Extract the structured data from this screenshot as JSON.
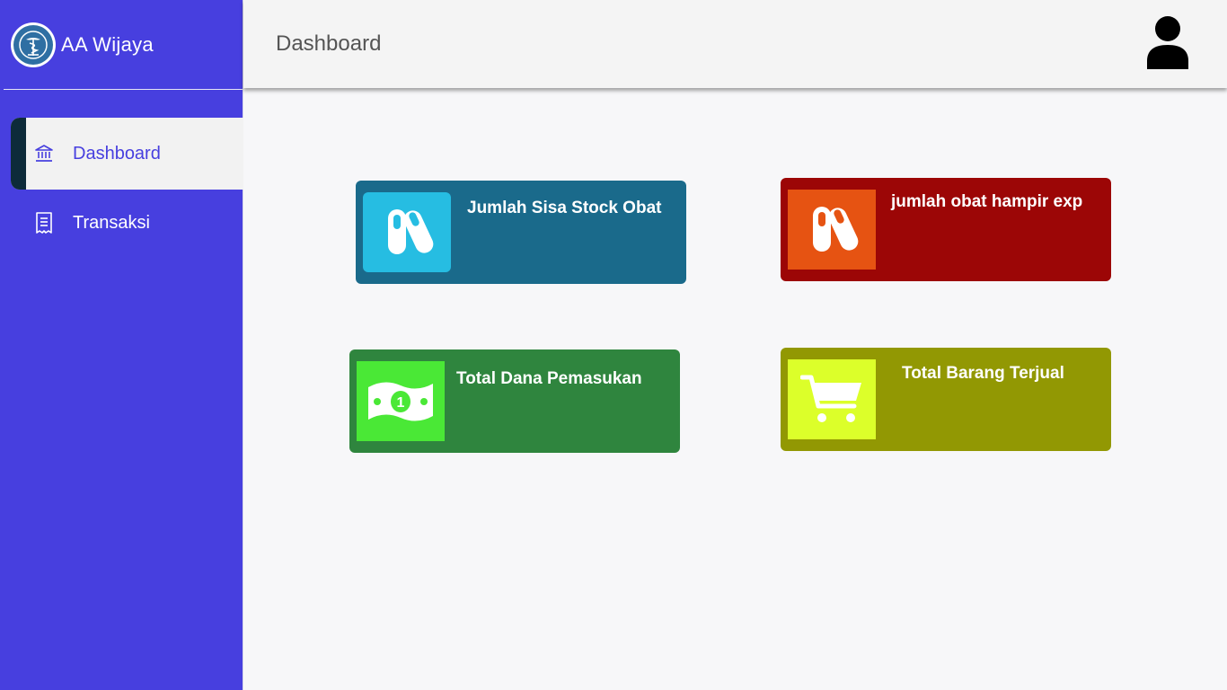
{
  "app": {
    "name": "AA Wijaya",
    "logo_icon": "caduceus-logo-icon"
  },
  "header": {
    "title": "Dashboard",
    "avatar_icon": "user-avatar-icon"
  },
  "sidebar": {
    "items": [
      {
        "label": "Dashboard",
        "icon": "bank-icon",
        "active": true
      },
      {
        "label": "Transaksi",
        "icon": "receipt-icon",
        "active": false
      }
    ]
  },
  "cards": [
    {
      "title": "Jumlah Sisa Stock Obat",
      "icon": "pills-icon",
      "bg": "#1a6a8b",
      "icon_bg": "#26bde2"
    },
    {
      "title": "jumlah obat hampir exp",
      "icon": "pills-icon",
      "bg": "#9c0606",
      "icon_bg": "#e65312"
    },
    {
      "title": "Total Dana Pemasukan",
      "icon": "money-bill-icon",
      "bg": "#2f853e",
      "icon_bg": "#4ae836"
    },
    {
      "title": "Total Barang Terjual",
      "icon": "shopping-cart-icon",
      "bg": "#929803",
      "icon_bg": "#dcff2a"
    }
  ],
  "colors": {
    "sidebar": "#473fdf",
    "accent": "#473fdf",
    "header_bg": "#f4f4f4",
    "content_bg": "#f7f7f9"
  }
}
